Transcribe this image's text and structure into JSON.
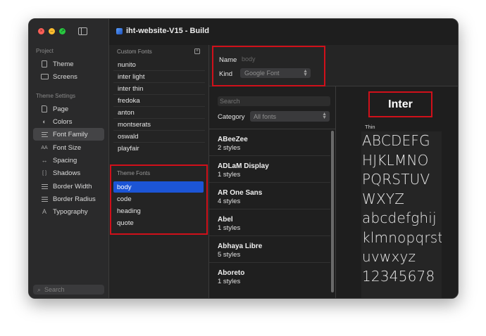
{
  "window": {
    "title": "iht-website-V15 - Build"
  },
  "sidebar": {
    "project_label": "Project",
    "project_items": [
      {
        "label": "Theme",
        "icon": "theme-icon"
      },
      {
        "label": "Screens",
        "icon": "screens-icon"
      }
    ],
    "settings_label": "Theme Settings",
    "settings_items": [
      {
        "label": "Page",
        "icon": "page-icon"
      },
      {
        "label": "Colors",
        "icon": "palette-icon"
      },
      {
        "label": "Font Family",
        "icon": "font-family-icon",
        "selected": true
      },
      {
        "label": "Font Size",
        "icon": "font-size-icon",
        "glyph": "AA"
      },
      {
        "label": "Spacing",
        "icon": "spacing-icon",
        "glyph": "↔"
      },
      {
        "label": "Shadows",
        "icon": "shadows-icon",
        "glyph": "[ ]"
      },
      {
        "label": "Border Width",
        "icon": "border-width-icon"
      },
      {
        "label": "Border Radius",
        "icon": "border-radius-icon"
      },
      {
        "label": "Typography",
        "icon": "typography-icon",
        "glyph": "A"
      }
    ],
    "search_placeholder": "Search"
  },
  "custom_fonts": {
    "header": "Custom Fonts",
    "items": [
      "nunito",
      "inter light",
      "inter thin",
      "fredoka",
      "anton",
      "montserats",
      "oswald",
      "playfair"
    ]
  },
  "theme_fonts": {
    "header": "Theme Fonts",
    "items": [
      "body",
      "code",
      "heading",
      "quote"
    ],
    "selected": "body"
  },
  "details": {
    "name_label": "Name",
    "name_placeholder": "body",
    "kind_label": "Kind",
    "kind_value": "Google Font"
  },
  "browser": {
    "search_placeholder": "Search",
    "category_label": "Category",
    "category_value": "All fonts",
    "fonts": [
      {
        "name": "ABeeZee",
        "styles": "2 styles"
      },
      {
        "name": "ADLaM Display",
        "styles": "1 styles"
      },
      {
        "name": "AR One Sans",
        "styles": "4 styles"
      },
      {
        "name": "Abel",
        "styles": "1 styles"
      },
      {
        "name": "Abhaya Libre",
        "styles": "5 styles"
      },
      {
        "name": "Aboreto",
        "styles": "1 styles"
      }
    ]
  },
  "preview": {
    "font_name": "Inter",
    "weight_label": "Thin",
    "sample_lines": [
      "ABCDEFG",
      "HJKLMNO",
      "PQRSTUV",
      "WXYZ",
      "abcdefghij",
      "klmnopqrst",
      "uvwxyz",
      "12345678"
    ]
  },
  "colors": {
    "highlight_border": "#d0101a",
    "selection": "#1c55d6",
    "window_bg": "#1e1e1e",
    "sidebar_bg": "#2a2a2b"
  }
}
